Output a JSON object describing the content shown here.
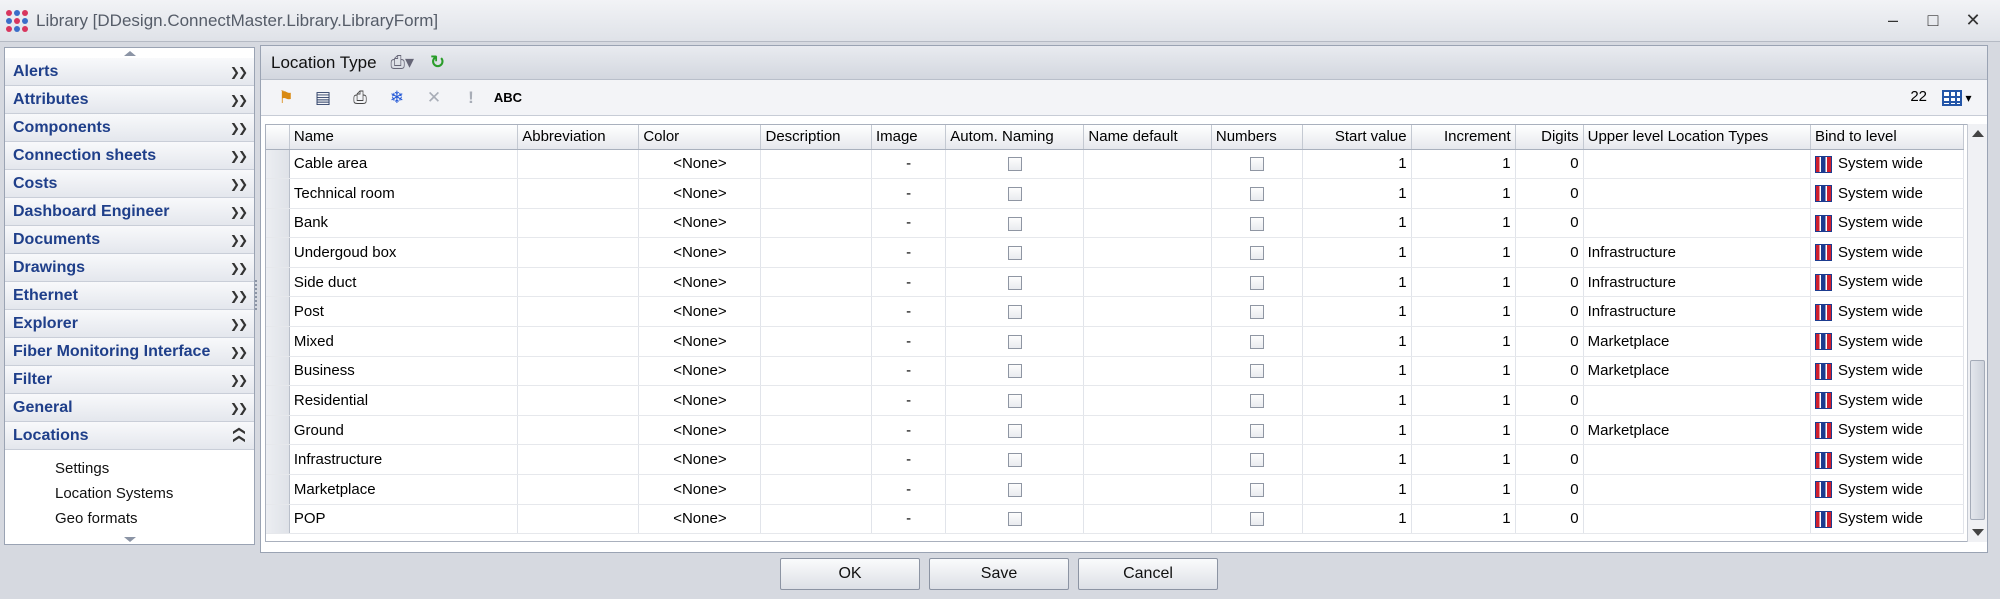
{
  "window": {
    "title": "Library [DDesign.ConnectMaster.Library.LibraryForm]",
    "minimize": "–",
    "maximize": "□",
    "close": "✕"
  },
  "sidebar": {
    "groups": [
      {
        "label": "Alerts"
      },
      {
        "label": "Attributes"
      },
      {
        "label": "Components"
      },
      {
        "label": "Connection sheets"
      },
      {
        "label": "Costs"
      },
      {
        "label": "Dashboard Engineer"
      },
      {
        "label": "Documents"
      },
      {
        "label": "Drawings"
      },
      {
        "label": "Ethernet"
      },
      {
        "label": "Explorer"
      },
      {
        "label": "Fiber Monitoring Interface"
      },
      {
        "label": "Filter"
      },
      {
        "label": "General"
      },
      {
        "label": "Locations"
      }
    ],
    "expanded_items": [
      "Settings",
      "Location Systems",
      "Geo formats"
    ]
  },
  "panel": {
    "title": "Location Type",
    "row_count": "22"
  },
  "grid": {
    "columns": [
      "Name",
      "Abbreviation",
      "Color",
      "Description",
      "Image",
      "Autom. Naming",
      "Name default",
      "Numbers",
      "Start value",
      "Increment",
      "Digits",
      "Upper level Location Types",
      "Bind to level"
    ],
    "rows": [
      {
        "name": "Cable area",
        "color": "<None>",
        "image": "-",
        "start": "1",
        "inc": "1",
        "digits": "0",
        "upper": "",
        "bind": "System wide"
      },
      {
        "name": "Technical room",
        "color": "<None>",
        "image": "-",
        "start": "1",
        "inc": "1",
        "digits": "0",
        "upper": "",
        "bind": "System wide"
      },
      {
        "name": "Bank",
        "color": "<None>",
        "image": "-",
        "start": "1",
        "inc": "1",
        "digits": "0",
        "upper": "",
        "bind": "System wide"
      },
      {
        "name": "Undergoud box",
        "color": "<None>",
        "image": "-",
        "start": "1",
        "inc": "1",
        "digits": "0",
        "upper": "Infrastructure",
        "bind": "System wide"
      },
      {
        "name": "Side duct",
        "color": "<None>",
        "image": "-",
        "start": "1",
        "inc": "1",
        "digits": "0",
        "upper": "Infrastructure",
        "bind": "System wide"
      },
      {
        "name": "Post",
        "color": "<None>",
        "image": "-",
        "start": "1",
        "inc": "1",
        "digits": "0",
        "upper": "Infrastructure",
        "bind": "System wide"
      },
      {
        "name": "Mixed",
        "color": "<None>",
        "image": "-",
        "start": "1",
        "inc": "1",
        "digits": "0",
        "upper": "Marketplace",
        "bind": "System wide"
      },
      {
        "name": "Business",
        "color": "<None>",
        "image": "-",
        "start": "1",
        "inc": "1",
        "digits": "0",
        "upper": "Marketplace",
        "bind": "System wide"
      },
      {
        "name": "Residential",
        "color": "<None>",
        "image": "-",
        "start": "1",
        "inc": "1",
        "digits": "0",
        "upper": "",
        "bind": "System wide"
      },
      {
        "name": "Ground",
        "color": "<None>",
        "image": "-",
        "start": "1",
        "inc": "1",
        "digits": "0",
        "upper": "Marketplace",
        "bind": "System wide"
      },
      {
        "name": "Infrastructure",
        "color": "<None>",
        "image": "-",
        "start": "1",
        "inc": "1",
        "digits": "0",
        "upper": "",
        "bind": "System wide"
      },
      {
        "name": "Marketplace",
        "color": "<None>",
        "image": "-",
        "start": "1",
        "inc": "1",
        "digits": "0",
        "upper": "",
        "bind": "System wide"
      },
      {
        "name": "POP",
        "color": "<None>",
        "image": "-",
        "start": "1",
        "inc": "1",
        "digits": "0",
        "upper": "",
        "bind": "System wide"
      }
    ]
  },
  "footer": {
    "ok": "OK",
    "save": "Save",
    "cancel": "Cancel"
  },
  "icons": {
    "chevron_down": "chevrons-down-icon",
    "chevron_up": "chevrons-up-icon",
    "toolbar": [
      "add-filter-icon",
      "save-layout-icon",
      "print-icon",
      "freeze-icon",
      "delete-icon",
      "exclamation-icon",
      "spellcheck-icon"
    ]
  }
}
